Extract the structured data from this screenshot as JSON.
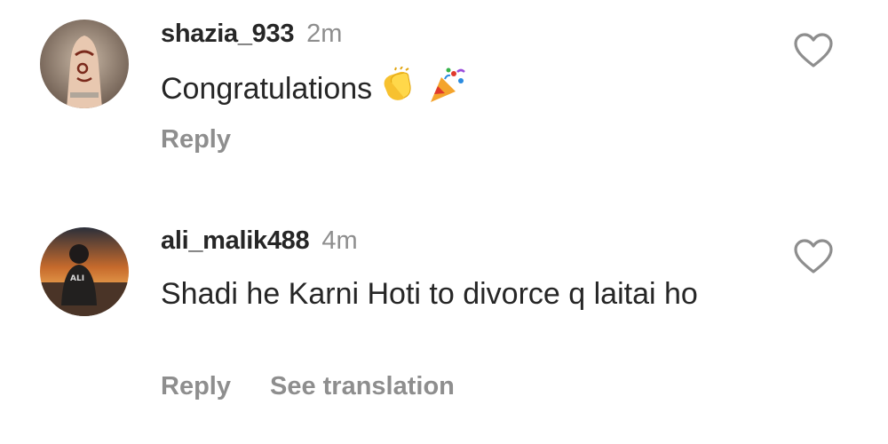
{
  "comments": [
    {
      "username": "shazia_933",
      "time": "2m",
      "text": "Congratulations",
      "emojis": [
        "clapping-hands",
        "party-popper"
      ],
      "actions": [
        "Reply"
      ],
      "avatar_icon": "avatar-henna-hand"
    },
    {
      "username": "ali_malik488",
      "time": "4m",
      "text": "Shadi he Karni Hoti to divorce q laitai ho",
      "actions": [
        "Reply",
        "See translation"
      ],
      "avatar_icon": "avatar-boy-sunset",
      "avatar_caption": "ALI"
    }
  ],
  "icons": {
    "like": "heart-outline-icon"
  },
  "colors": {
    "text": "#262626",
    "secondary": "#8e8e8e",
    "background": "#ffffff"
  }
}
